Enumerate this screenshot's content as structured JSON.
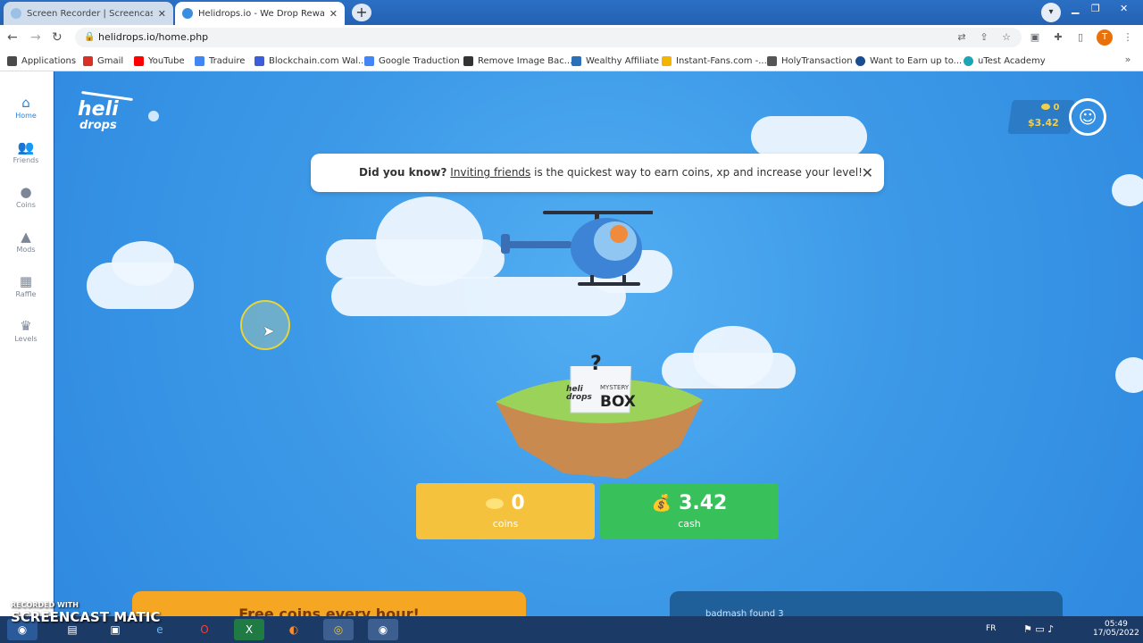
{
  "browser": {
    "tabs": [
      {
        "title": "Screen Recorder | Screencast-O-M",
        "active": false
      },
      {
        "title": "Helidrops.io - We Drop Rewards!",
        "active": true
      }
    ],
    "url": "helidrops.io/home.php",
    "profile_initial": "T",
    "bookmarks": [
      {
        "label": "Applications",
        "color": "#4a4a4a"
      },
      {
        "label": "Gmail",
        "color": "#d93025"
      },
      {
        "label": "YouTube",
        "color": "#ff0000"
      },
      {
        "label": "Traduire",
        "color": "#4285f4"
      },
      {
        "label": "Blockchain.com Wal...",
        "color": "#3b5dd9"
      },
      {
        "label": "Google Traduction",
        "color": "#4285f4"
      },
      {
        "label": "Remove Image Bac...",
        "color": "#333333"
      },
      {
        "label": "Wealthy Affiliate",
        "color": "#2a6fb8"
      },
      {
        "label": "Instant-Fans.com -...",
        "color": "#f5b400"
      },
      {
        "label": "HolyTransaction",
        "color": "#555555"
      },
      {
        "label": "Want to Earn up to...",
        "color": "#1a4d8f"
      },
      {
        "label": "uTest Academy",
        "color": "#1aa6b7"
      }
    ]
  },
  "sidebar": {
    "items": [
      {
        "label": "Home",
        "icon": "home-icon",
        "glyph": "⌂"
      },
      {
        "label": "Friends",
        "icon": "friends-icon",
        "glyph": "👥"
      },
      {
        "label": "Coins",
        "icon": "coins-icon",
        "glyph": "●"
      },
      {
        "label": "Mods",
        "icon": "mods-icon",
        "glyph": "▲"
      },
      {
        "label": "Raffle",
        "icon": "raffle-icon",
        "glyph": "▦"
      },
      {
        "label": "Levels",
        "icon": "levels-icon",
        "glyph": "♛"
      }
    ]
  },
  "header": {
    "logo_line1": "heli",
    "logo_line2": "drops",
    "balance_coins": "0",
    "balance_cash": "$3.42"
  },
  "tip": {
    "lead": "Did you know?",
    "link": "Inviting friends",
    "rest": " is the quickest way to earn coins, xp and increase your level!"
  },
  "mystery_box": {
    "brand": "heli drops",
    "label_top": "MYSTERY",
    "label_bottom": "BOX",
    "mark": "?"
  },
  "stats": {
    "coins_value": "0",
    "coins_label": "coins",
    "cash_value": "3.42",
    "cash_label": "cash"
  },
  "cards": {
    "left_title": "Free coins every hour!",
    "right_text": "badmash found",
    "right_count": "3"
  },
  "taskbar": {
    "watermark_small": "RECORDED WITH",
    "watermark_big": "SCREENCAST MATIC",
    "lang": "FR",
    "time": "05:49",
    "date": "17/05/2022"
  },
  "colors": {
    "sky": "#3d9ae8",
    "coins_card": "#f4c23c",
    "cash_card": "#38c05a",
    "accent_gold": "#f2d04a"
  }
}
